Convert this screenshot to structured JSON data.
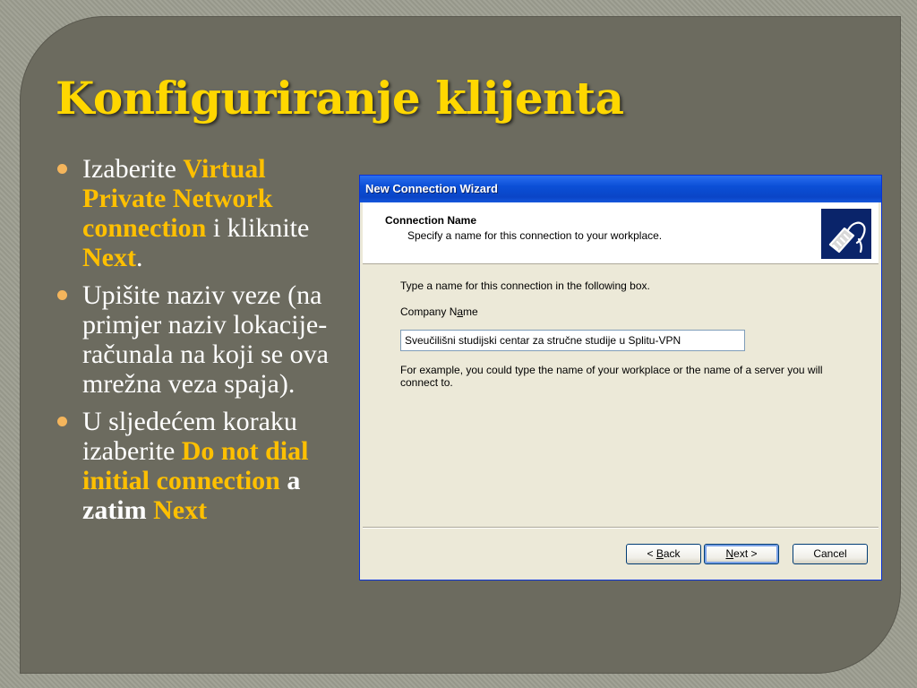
{
  "slide": {
    "title": "Konfiguriranje klijenta",
    "bullets": [
      {
        "t1": "Izaberite ",
        "h1": "Virtual Private Network connection",
        "t2": " i kliknite ",
        "h2": "Next",
        "t3": "."
      },
      {
        "t1": "Upišite naziv veze (na primjer naziv lokacije-računala na koji se ova mrežna veza spaja)."
      },
      {
        "t1": "U sljedećem koraku izaberite ",
        "h1": "Do not dial initial connection",
        "b1": " a zatim ",
        "h2": " Next"
      }
    ],
    "colors": {
      "highlight": "#ffc000",
      "background": "#6c6b5f",
      "title": "#ffd700"
    }
  },
  "dialog": {
    "title": "New Connection Wizard",
    "header_title": "Connection Name",
    "header_subtitle": "Specify a name for this connection to your workplace.",
    "icon": "network-connection-icon",
    "instruction": "Type a name for this connection in the following box.",
    "company_label_pre": "Company N",
    "company_label_ul": "a",
    "company_label_post": "me",
    "company_value": "Sveučilišni studijski centar za stručne studije u Splitu-VPN",
    "hint": "For example, you could type the name of your workplace or the name of a server you will connect to.",
    "buttons": {
      "back_pre": "< ",
      "back_ul": "B",
      "back_post": "ack",
      "next_ul": "N",
      "next_post": "ext >",
      "cancel": "Cancel"
    }
  }
}
